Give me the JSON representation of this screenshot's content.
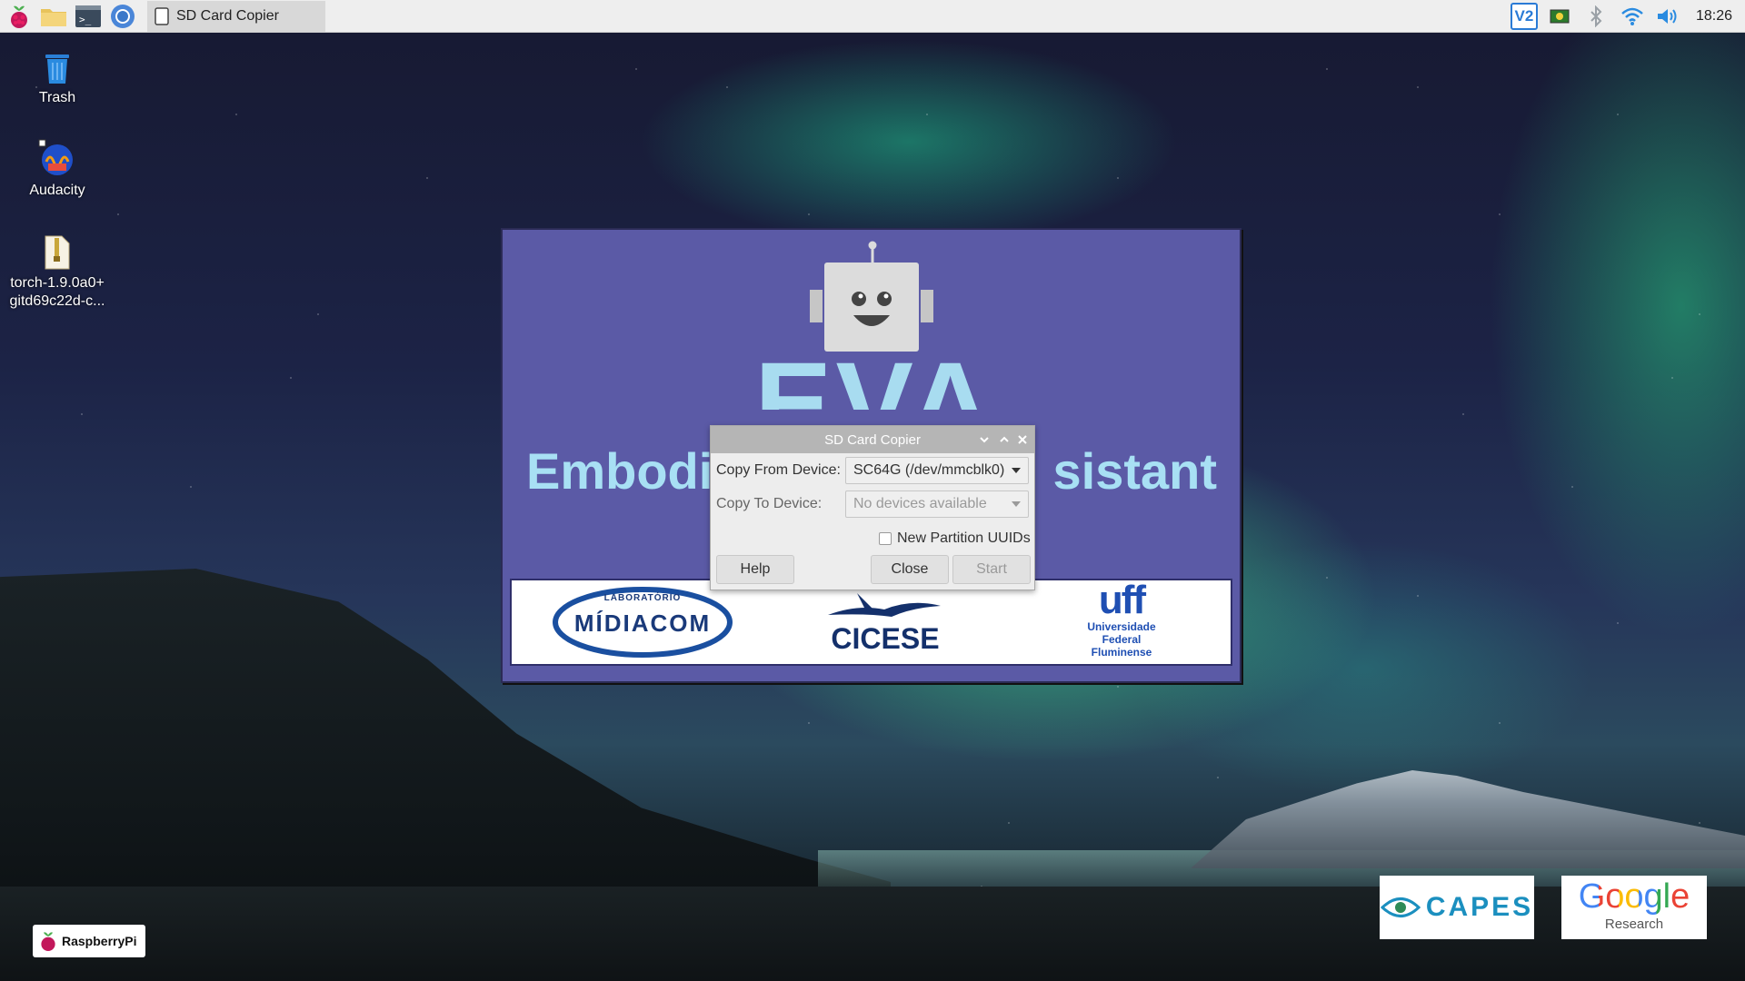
{
  "taskbar": {
    "task_title": "SD Card Copier",
    "clock": "18:26",
    "vnc_label": "V2"
  },
  "desktop": {
    "icons": [
      {
        "label": "Trash"
      },
      {
        "label": "Audacity"
      },
      {
        "label_line1": "torch-1.9.0a0+",
        "label_line2": "gitd69c22d-c..."
      }
    ]
  },
  "splash": {
    "title": "EVA",
    "subtitle_left": "Embodi",
    "subtitle_right": "sistant",
    "logos": {
      "midiacom_top": "LABORATÓRIO",
      "midiacom_main": "MÍDIACOM",
      "cicese": "CICESE",
      "uff_main": "uff",
      "uff_line1": "Universidade",
      "uff_line2": "Federal",
      "uff_line3": "Fluminense"
    }
  },
  "dialog": {
    "title": "SD Card Copier",
    "copy_from_label": "Copy From Device:",
    "copy_from_value": "SC64G  (/dev/mmcblk0)",
    "copy_to_label": "Copy To Device:",
    "copy_to_value": "No devices available",
    "checkbox_label": "New Partition UUIDs",
    "help_label": "Help",
    "close_label": "Close",
    "start_label": "Start"
  },
  "corner_logos": {
    "raspberry": "RaspberryPi",
    "capes": "CAPES",
    "google": "Google",
    "google_sub": "Research"
  },
  "colors": {
    "splash_bg": "#5b5aa6",
    "eva_text": "#a8dcf0",
    "taskbar_bg": "#eeeeee"
  }
}
